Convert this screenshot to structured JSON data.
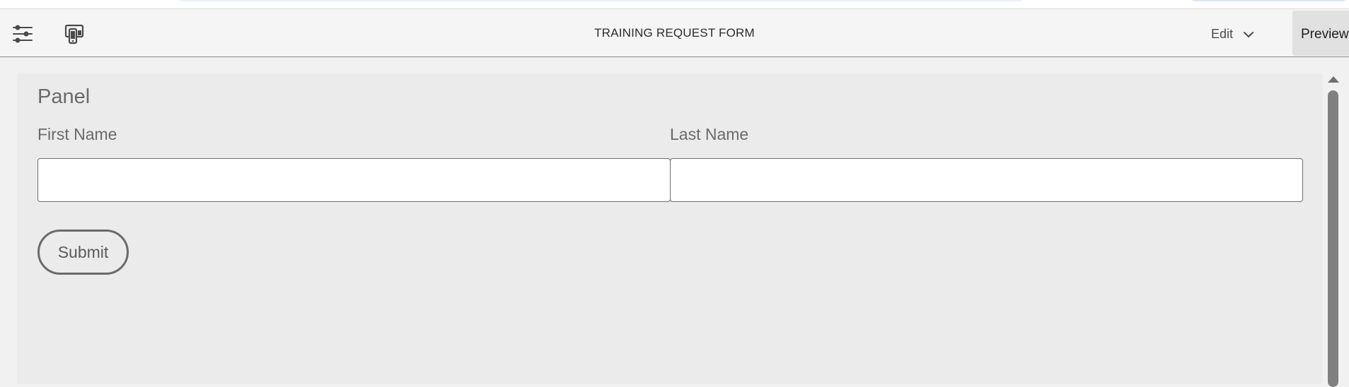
{
  "toolbar": {
    "icons": {
      "properties": "sliders-icon",
      "emulator": "mobile-devices-icon"
    },
    "title": "TRAINING REQUEST FORM",
    "mode_label": "Edit",
    "preview_label": "Preview"
  },
  "panel": {
    "title": "Panel",
    "fields": {
      "first_name": {
        "label": "First Name",
        "value": "",
        "placeholder": ""
      },
      "last_name": {
        "label": "Last Name",
        "value": "",
        "placeholder": ""
      }
    },
    "submit_label": "Submit"
  },
  "colors": {
    "toolbar_bg": "#f5f5f5",
    "canvas_bg": "#ebebeb",
    "label_text": "#6a6a6a",
    "preview_bg": "#e1e1e1"
  }
}
